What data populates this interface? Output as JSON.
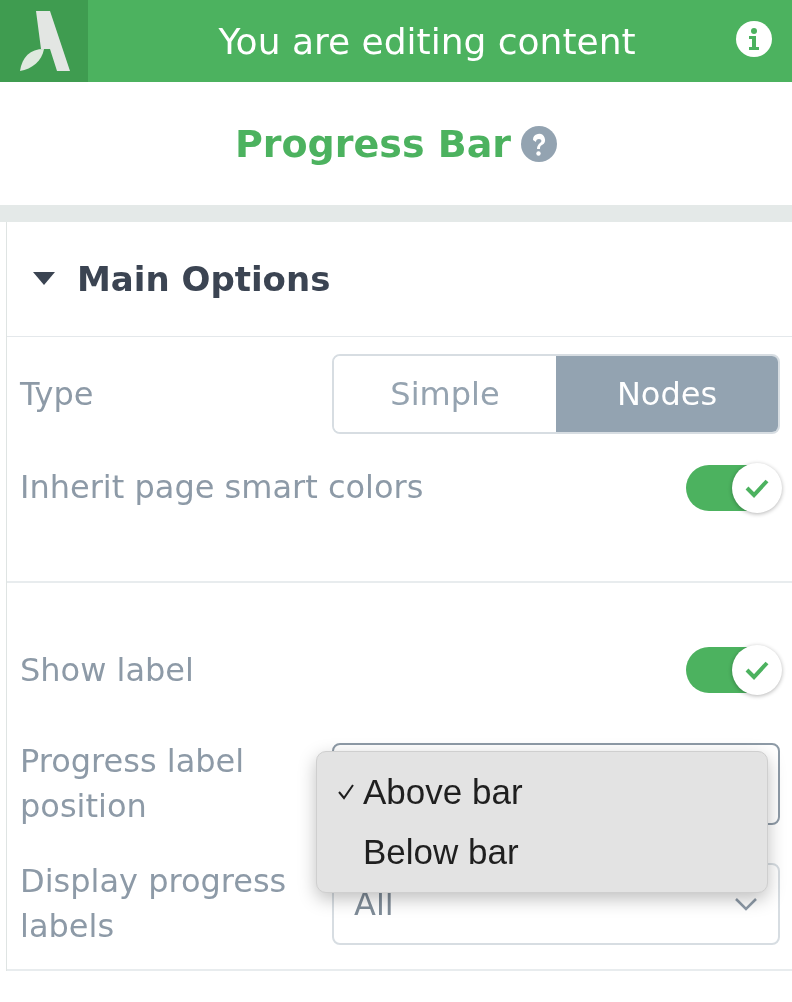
{
  "header": {
    "title": "You are editing content"
  },
  "panel_title": "Progress Bar",
  "section": {
    "title": "Main Options",
    "expanded": true,
    "groups": [
      [
        {
          "kind": "segmented",
          "label": "Type",
          "options": [
            {
              "label": "Simple",
              "selected": false
            },
            {
              "label": "Nodes",
              "selected": true
            }
          ]
        },
        {
          "kind": "toggle",
          "label": "Inherit page smart colors",
          "on": true
        }
      ],
      [
        {
          "kind": "toggle",
          "label": "Show label",
          "on": true
        },
        {
          "kind": "select",
          "label": "Progress label position",
          "open": true,
          "menu": [
            {
              "label": "Above bar",
              "selected": true
            },
            {
              "label": "Below bar",
              "selected": false
            }
          ]
        },
        {
          "kind": "select",
          "label": "Display progress labels",
          "value": "All",
          "open": false
        }
      ]
    ]
  }
}
